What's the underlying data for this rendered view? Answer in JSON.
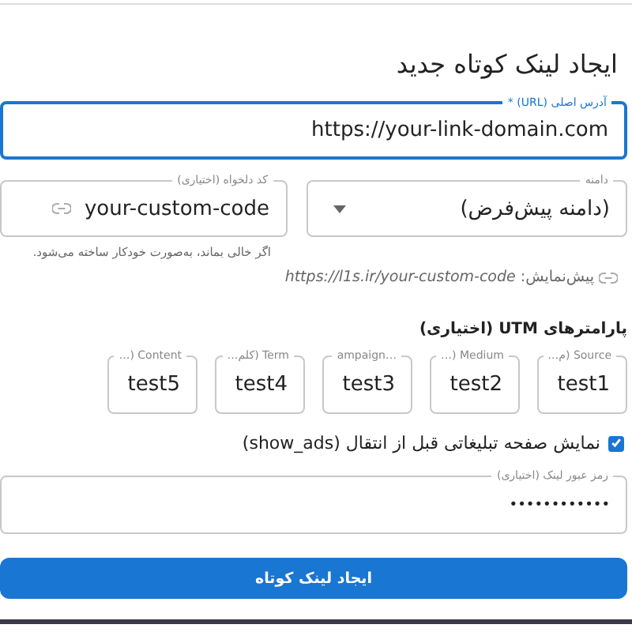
{
  "title": "ایجاد لینک کوتاه جدید",
  "url_field": {
    "label": "آدرس اصلی (URL) *",
    "value": "https://your-link-domain.com",
    "focused": true
  },
  "domain_field": {
    "label": "دامنه",
    "value": "(دامنه پیش‌فرض)"
  },
  "custom_code_field": {
    "label": "کد دلخواه (اختیاری)",
    "value": "your-custom-code",
    "helper": "اگر خالی بماند، به‌صورت خودکار ساخته می‌شود."
  },
  "preview": "پیش‌نمایش: *https://l1s.ir/your-custom-code*",
  "utm": {
    "heading": "پارامترهای UTM (اختیاری)",
    "fields": [
      {
        "label": "Source (م…",
        "value": "test1"
      },
      {
        "label": "Medium (…",
        "value": "test2"
      },
      {
        "label": "…ampaign",
        "value": "test3"
      },
      {
        "label": "Term (کلم…",
        "value": "test4"
      },
      {
        "label": "Content (…",
        "value": "test5"
      }
    ]
  },
  "show_ads": {
    "label": "نمایش صفحه تبلیغاتی قبل از انتقال (show_ads)",
    "checked": true
  },
  "password_field": {
    "label": "رمز عبور لینک (اختیاری)",
    "value": "••••••••••••"
  },
  "submit_button": "ایجاد لینک کوتاه"
}
